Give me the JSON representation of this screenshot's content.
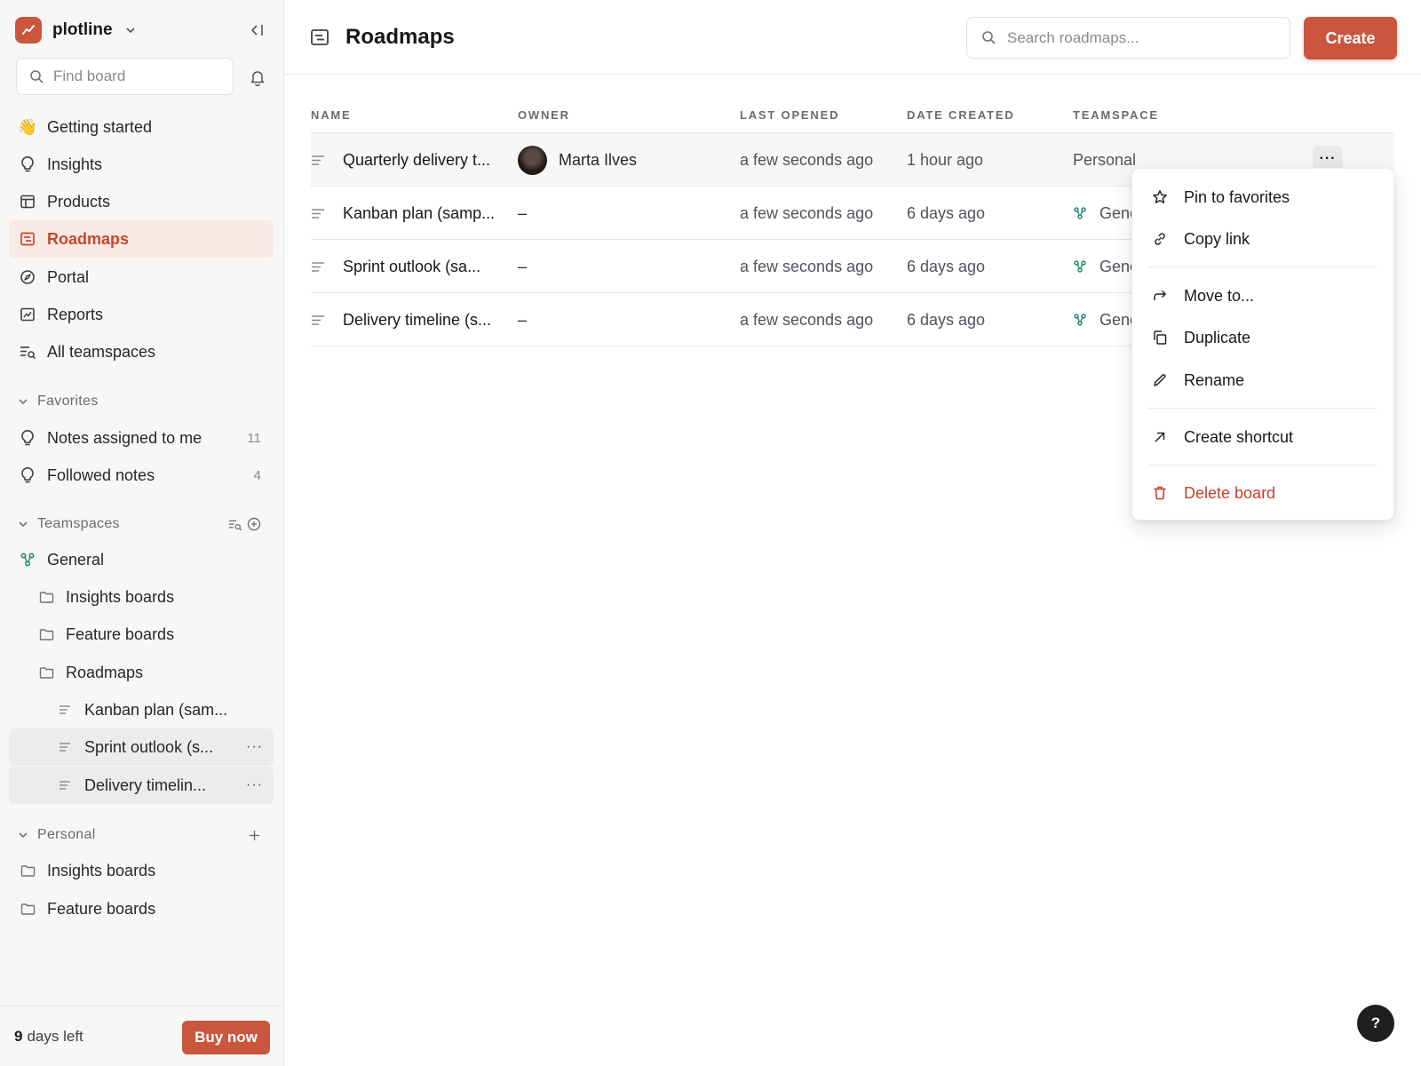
{
  "workspace": {
    "name": "plotline",
    "logo_icon": "chart-line-icon",
    "brand_color": "#c9563d"
  },
  "sidebar": {
    "find_placeholder": "Find board",
    "nav": [
      {
        "label": "Getting started",
        "icon": "waving-hand-icon"
      },
      {
        "label": "Insights",
        "icon": "lightbulb-icon"
      },
      {
        "label": "Products",
        "icon": "layout-icon"
      },
      {
        "label": "Roadmaps",
        "icon": "roadmap-icon",
        "active": true
      },
      {
        "label": "Portal",
        "icon": "compass-icon"
      },
      {
        "label": "Reports",
        "icon": "chart-icon"
      },
      {
        "label": "All teamspaces",
        "icon": "list-search-icon"
      }
    ],
    "favorites": {
      "title": "Favorites",
      "items": [
        {
          "label": "Notes assigned to me",
          "count": "11"
        },
        {
          "label": "Followed notes",
          "count": "4"
        }
      ]
    },
    "teamspaces": {
      "title": "Teamspaces",
      "general": "General",
      "folders": [
        "Insights boards",
        "Feature boards",
        "Roadmaps"
      ],
      "roadmaps": [
        "Kanban plan (sam...",
        "Sprint outlook (s...",
        "Delivery timelin..."
      ],
      "more": "···"
    },
    "personal": {
      "title": "Personal",
      "folders": [
        "Insights boards",
        "Feature boards"
      ]
    },
    "trial": {
      "days": "9",
      "suffix": "days left",
      "buy_label": "Buy now"
    }
  },
  "header": {
    "title": "Roadmaps",
    "search_placeholder": "Search roadmaps...",
    "create_label": "Create"
  },
  "table": {
    "columns": [
      "NAME",
      "OWNER",
      "LAST OPENED",
      "DATE CREATED",
      "TEAMSPACE"
    ],
    "rows": [
      {
        "name": "Quarterly delivery t...",
        "owner": "Marta Ilves",
        "last_opened": "a few seconds ago",
        "date_created": "1 hour ago",
        "teamspace": "Personal"
      },
      {
        "name": "Kanban plan (samp...",
        "owner": "–",
        "last_opened": "a few seconds ago",
        "date_created": "6 days ago",
        "teamspace": "General"
      },
      {
        "name": "Sprint outlook (sa...",
        "owner": "–",
        "last_opened": "a few seconds ago",
        "date_created": "6 days ago",
        "teamspace": "General"
      },
      {
        "name": "Delivery timeline (s...",
        "owner": "–",
        "last_opened": "a few seconds ago",
        "date_created": "6 days ago",
        "teamspace": "General"
      }
    ],
    "row_more": "···"
  },
  "context_menu": {
    "items": [
      {
        "label": "Pin to favorites",
        "icon": "star-icon"
      },
      {
        "label": "Copy link",
        "icon": "link-icon"
      },
      {
        "label": "Move to...",
        "icon": "arrow-forward-icon"
      },
      {
        "label": "Duplicate",
        "icon": "copy-icon"
      },
      {
        "label": "Rename",
        "icon": "pencil-icon"
      },
      {
        "label": "Create shortcut",
        "icon": "arrow-up-right-icon"
      },
      {
        "label": "Delete board",
        "icon": "trash-icon",
        "danger": true
      }
    ]
  },
  "help": {
    "label": "?"
  },
  "colors": {
    "accent": "#c9563d",
    "active_bg": "#fbe9e3",
    "danger": "#c2412d",
    "teamspace_icon": "#1f8a70"
  }
}
